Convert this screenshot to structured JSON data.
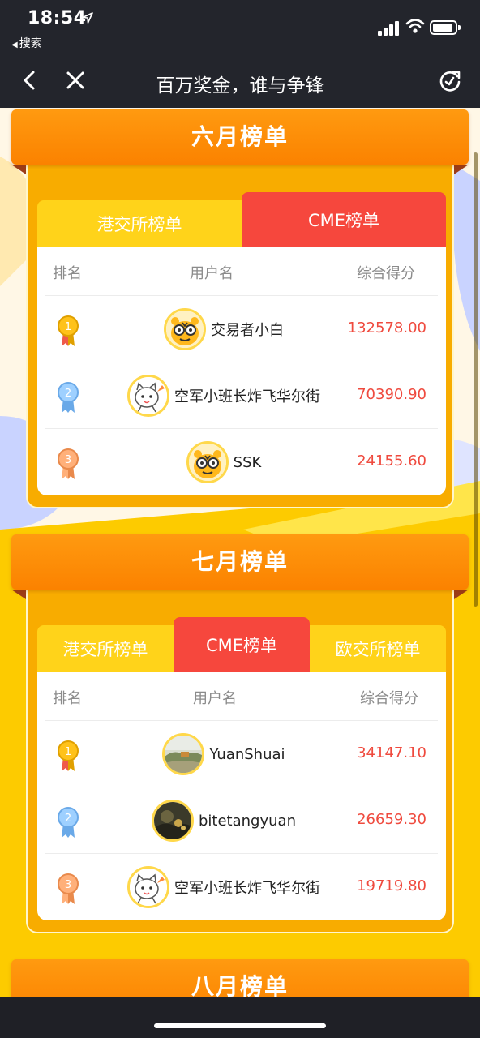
{
  "status_bar": {
    "time": "18:54",
    "back_app": "搜索",
    "icons": [
      "location-arrow-icon",
      "signal-icon",
      "wifi-icon",
      "battery-icon"
    ]
  },
  "nav": {
    "title": "百万奖金，谁与争锋",
    "icons": [
      "back-chevron-icon",
      "close-icon",
      "refresh-icon"
    ]
  },
  "table_headers": {
    "rank": "排名",
    "user": "用户名",
    "score": "综合得分"
  },
  "colors": {
    "title_bar": "#fb8200",
    "active_tab": "#f6473d",
    "inactive_tab": "#ffd31a",
    "score": "#ef4a3e",
    "background": "#fdcb00"
  },
  "sections": [
    {
      "title": "六月榜单",
      "tabs": [
        {
          "label": "港交所榜单",
          "active": false
        },
        {
          "label": "CME榜单",
          "active": true
        }
      ],
      "rows": [
        {
          "rank": "1",
          "avatar": "tiger-avatar",
          "name": "交易者小白",
          "score": "132578.00"
        },
        {
          "rank": "2",
          "avatar": "cartoon-cat-avatar",
          "name": "空军小班长炸飞华尔街",
          "score": "70390.90"
        },
        {
          "rank": "3",
          "avatar": "tiger-avatar",
          "name": "SSK",
          "score": "24155.60"
        }
      ]
    },
    {
      "title": "七月榜单",
      "tabs": [
        {
          "label": "港交所榜单",
          "active": false
        },
        {
          "label": "CME榜单",
          "active": true
        },
        {
          "label": "欧交所榜单",
          "active": false
        }
      ],
      "rows": [
        {
          "rank": "1",
          "avatar": "landscape-photo-avatar",
          "name": "YuanShuai",
          "score": "34147.10"
        },
        {
          "rank": "2",
          "avatar": "dark-photo-avatar",
          "name": "bitetangyuan",
          "score": "26659.30"
        },
        {
          "rank": "3",
          "avatar": "cartoon-cat-avatar",
          "name": "空军小班长炸飞华尔街",
          "score": "19719.80"
        }
      ]
    },
    {
      "title": "八月榜单"
    }
  ]
}
